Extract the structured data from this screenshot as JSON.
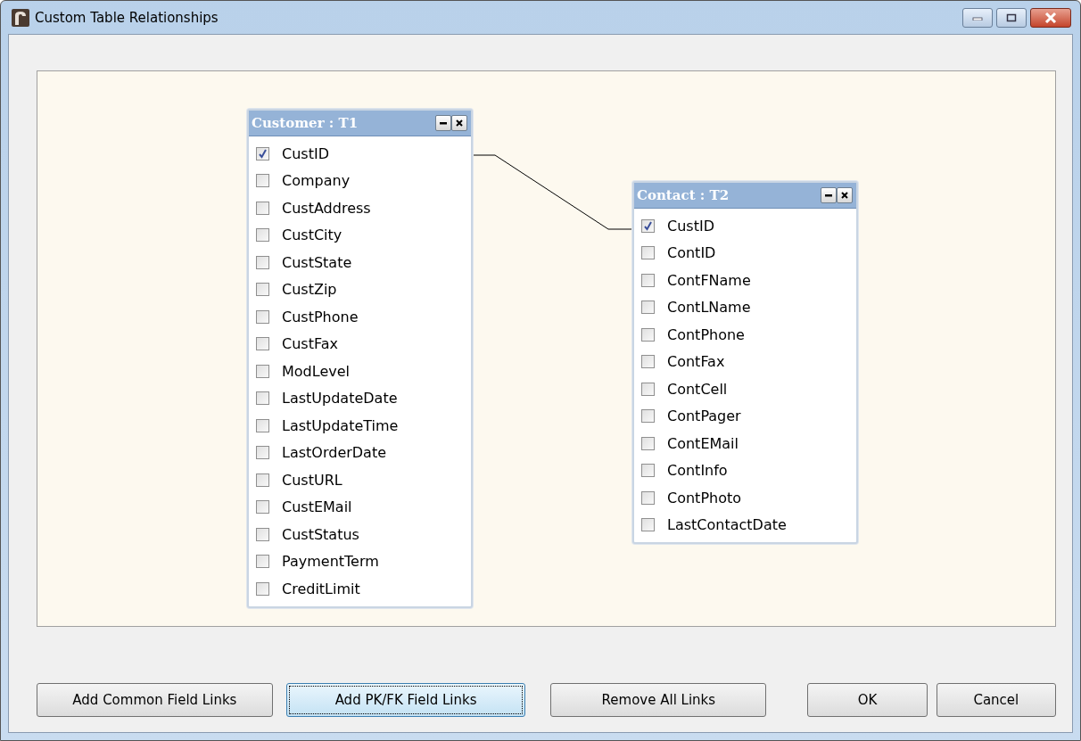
{
  "window": {
    "title": "Custom Table Relationships"
  },
  "tables": [
    {
      "title": "Customer : T1",
      "fields": [
        {
          "name": "CustID",
          "checked": true
        },
        {
          "name": "Company",
          "checked": false
        },
        {
          "name": "CustAddress",
          "checked": false
        },
        {
          "name": "CustCity",
          "checked": false
        },
        {
          "name": "CustState",
          "checked": false
        },
        {
          "name": "CustZip",
          "checked": false
        },
        {
          "name": "CustPhone",
          "checked": false
        },
        {
          "name": "CustFax",
          "checked": false
        },
        {
          "name": "ModLevel",
          "checked": false
        },
        {
          "name": "LastUpdateDate",
          "checked": false
        },
        {
          "name": "LastUpdateTime",
          "checked": false
        },
        {
          "name": "LastOrderDate",
          "checked": false
        },
        {
          "name": "CustURL",
          "checked": false
        },
        {
          "name": "CustEMail",
          "checked": false
        },
        {
          "name": "CustStatus",
          "checked": false
        },
        {
          "name": "PaymentTerm",
          "checked": false
        },
        {
          "name": "CreditLimit",
          "checked": false
        }
      ]
    },
    {
      "title": "Contact : T2",
      "fields": [
        {
          "name": "CustID",
          "checked": true
        },
        {
          "name": "ContID",
          "checked": false
        },
        {
          "name": "ContFName",
          "checked": false
        },
        {
          "name": "ContLName",
          "checked": false
        },
        {
          "name": "ContPhone",
          "checked": false
        },
        {
          "name": "ContFax",
          "checked": false
        },
        {
          "name": "ContCell",
          "checked": false
        },
        {
          "name": "ContPager",
          "checked": false
        },
        {
          "name": "ContEMail",
          "checked": false
        },
        {
          "name": "ContInfo",
          "checked": false
        },
        {
          "name": "ContPhoto",
          "checked": false
        },
        {
          "name": "LastContactDate",
          "checked": false
        }
      ]
    }
  ],
  "buttons": [
    {
      "label": "Add Common Field Links",
      "focused": false
    },
    {
      "label": "Add PK/FK Field Links",
      "focused": true
    },
    {
      "label": "Remove All Links",
      "focused": false
    },
    {
      "label": "OK",
      "focused": false
    },
    {
      "label": "Cancel",
      "focused": false
    }
  ]
}
